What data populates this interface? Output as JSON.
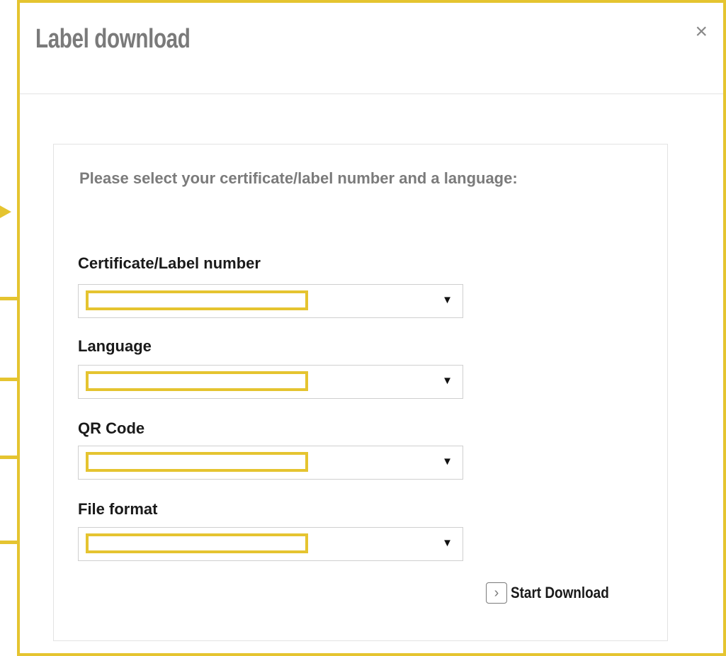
{
  "dialog": {
    "title": "Label download",
    "close_label": "×"
  },
  "form": {
    "intro": "Please select your certificate/label number and a language:",
    "fields": [
      {
        "label": "Certificate/Label number",
        "value": ""
      },
      {
        "label": "Language",
        "value": ""
      },
      {
        "label": "QR Code",
        "value": ""
      },
      {
        "label": "File format",
        "value": ""
      }
    ],
    "dropdown_arrow": "▼",
    "download_button": {
      "label": "Start Download",
      "icon": "chevron-right-icon",
      "icon_glyph": "›"
    }
  },
  "colors": {
    "highlight": "#e5c430",
    "title_gray": "#7a7a7a",
    "border_gray": "#e3e3e3"
  }
}
